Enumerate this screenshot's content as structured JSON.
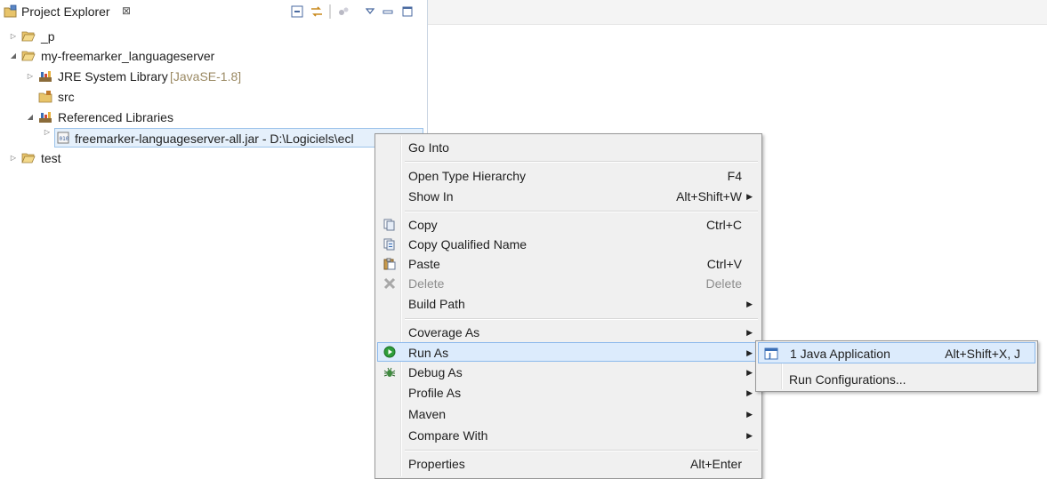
{
  "view": {
    "title": "Project Explorer",
    "close_glyph": "⊠"
  },
  "toolbar": {
    "collapse_all_icon": "collapse-all-icon",
    "link_editor_icon": "link-with-editor-icon",
    "filters_icon": "filters-icon",
    "view_menu_icon": "view-menu-icon",
    "minimize_icon": "minimize-icon",
    "maximize_icon": "maximize-icon"
  },
  "tree": {
    "items": [
      {
        "label": "_p",
        "decoration": ""
      },
      {
        "label": "my-freemarker_languageserver",
        "decoration": ""
      },
      {
        "label": "JRE System Library",
        "decoration": "[JavaSE-1.8]"
      },
      {
        "label": "src",
        "decoration": ""
      },
      {
        "label": "Referenced Libraries",
        "decoration": ""
      },
      {
        "label": "freemarker-languageserver-all.jar - D:\\Logiciels\\ecl",
        "decoration": ""
      },
      {
        "label": "test",
        "decoration": ""
      }
    ]
  },
  "context_menu": {
    "items": [
      {
        "label": "Go Into",
        "accel": ""
      },
      {
        "label": "Open Type Hierarchy",
        "accel": "F4"
      },
      {
        "label": "Show In",
        "accel": "Alt+Shift+W"
      },
      {
        "label": "Copy",
        "accel": "Ctrl+C"
      },
      {
        "label": "Copy Qualified Name",
        "accel": ""
      },
      {
        "label": "Paste",
        "accel": "Ctrl+V"
      },
      {
        "label": "Delete",
        "accel": "Delete"
      },
      {
        "label": "Build Path",
        "accel": ""
      },
      {
        "label": "Coverage As",
        "accel": ""
      },
      {
        "label": "Run As",
        "accel": ""
      },
      {
        "label": "Debug As",
        "accel": ""
      },
      {
        "label": "Profile As",
        "accel": ""
      },
      {
        "label": "Maven",
        "accel": ""
      },
      {
        "label": "Compare With",
        "accel": ""
      },
      {
        "label": "Properties",
        "accel": "Alt+Enter"
      }
    ],
    "submenu_arrow": "▶"
  },
  "run_as_submenu": {
    "items": [
      {
        "label": "1 Java Application",
        "accel": "Alt+Shift+X, J"
      },
      {
        "label": "Run Configurations...",
        "accel": ""
      }
    ]
  },
  "colors": {
    "selection_bg": "#e5f0fb",
    "menu_bg": "#f0f0f0",
    "menu_hover": "#dcebfc",
    "run_green": "#2e9e3a"
  }
}
